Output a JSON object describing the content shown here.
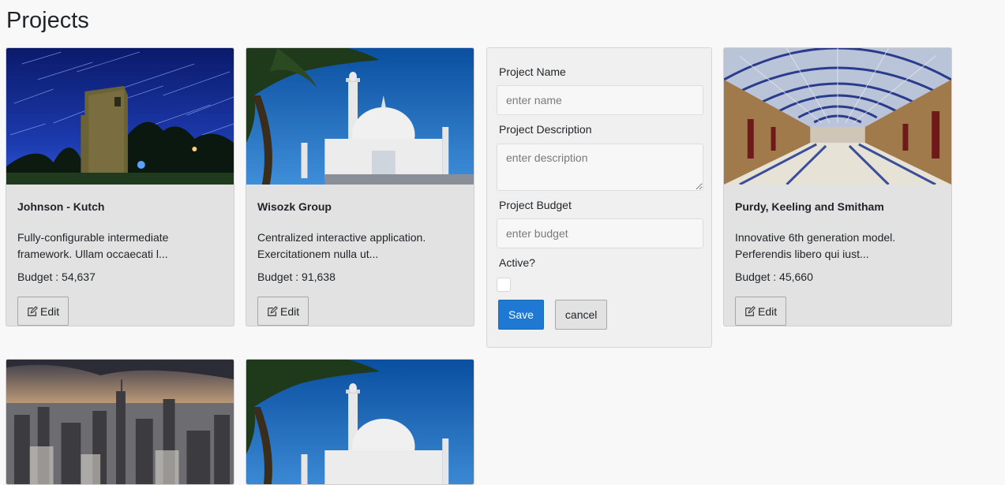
{
  "page": {
    "title": "Projects"
  },
  "projects": [
    {
      "name": "Johnson - Kutch",
      "description": "Fully-configurable intermediate framework. Ullam occaecati l...",
      "budget_text": "Budget : 54,637",
      "edit_label": "Edit",
      "image": "night-tower-startrails"
    },
    {
      "name": "Wisozk Group",
      "description": "Centralized interactive application. Exercitationem nulla ut...",
      "budget_text": "Budget : 91,638",
      "edit_label": "Edit",
      "image": "taj-mahal"
    },
    {
      "name": "Purdy, Keeling and Smitham",
      "description": "Innovative 6th generation model. Perferendis libero qui iust...",
      "budget_text": "Budget : 45,660",
      "edit_label": "Edit",
      "image": "arcade-hall"
    },
    {
      "image": "city-skyline"
    },
    {
      "image": "taj-mahal"
    }
  ],
  "form": {
    "name_label": "Project Name",
    "name_placeholder": "enter name",
    "description_label": "Project Description",
    "description_placeholder": "enter description",
    "budget_label": "Project Budget",
    "budget_placeholder": "enter budget",
    "active_label": "Active?",
    "active_checked": false,
    "save_label": "Save",
    "cancel_label": "cancel"
  },
  "colors": {
    "primary": "#1f78d1",
    "card_bg": "#e2e2e2",
    "page_bg": "#f8f8f8"
  }
}
